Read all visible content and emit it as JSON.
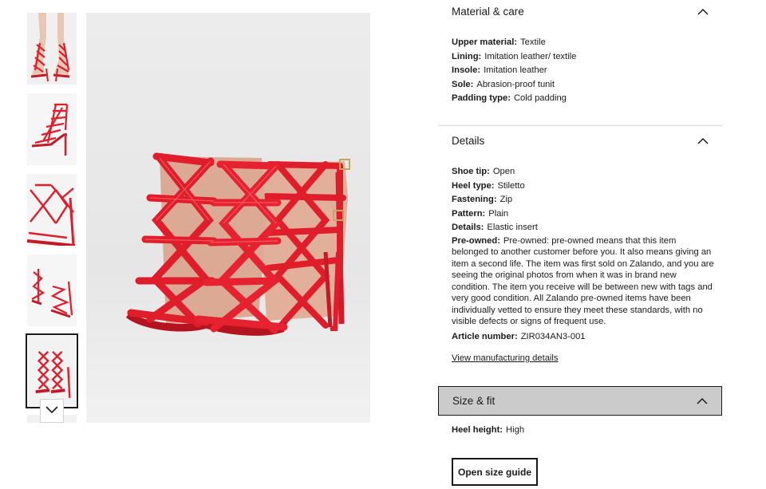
{
  "gallery": {
    "thumbnails": [
      {
        "view": "worn-on-feet"
      },
      {
        "view": "side-view"
      },
      {
        "view": "back-detail"
      },
      {
        "view": "pair-top-view"
      },
      {
        "view": "front-pair",
        "selected": true
      }
    ],
    "next_icon": "chevron-down-icon",
    "main_view": "front-pair"
  },
  "material_care": {
    "title": "Material & care",
    "icon": "chevron-up-icon",
    "rows": [
      {
        "key": "Upper material:",
        "value": "Textile"
      },
      {
        "key": "Lining:",
        "value": "Imitation leather/ textile"
      },
      {
        "key": "Insole:",
        "value": "Imitation leather"
      },
      {
        "key": "Sole:",
        "value": "Abrasion-proof tunit"
      },
      {
        "key": "Padding type:",
        "value": "Cold padding"
      }
    ]
  },
  "details": {
    "title": "Details",
    "icon": "chevron-up-icon",
    "rows": [
      {
        "key": "Shoe tip:",
        "value": "Open"
      },
      {
        "key": "Heel type:",
        "value": "Stiletto"
      },
      {
        "key": "Fastening:",
        "value": "Zip"
      },
      {
        "key": "Pattern:",
        "value": "Plain"
      },
      {
        "key": "Details:",
        "value": "Elastic insert"
      },
      {
        "key": "Pre-owned:",
        "value": "Pre-owned: pre-owned means that this item belonged to another customer before you. It also means giving an item a second life. The item was first sold on Zalando, and you are seeing the original photos from when it was in brand new condition. The item you receive will be between new with tags and very good condition. All Zalando pre-owned items have been individually vetted to ensure they meet these standards, with no visible defects or signs of frequent use."
      },
      {
        "key": "Article number:",
        "value": "ZIR034AN3-001"
      }
    ],
    "manufacturing_link": "View manufacturing details"
  },
  "size_fit": {
    "title": "Size & fit",
    "icon": "chevron-up-icon",
    "rows": [
      {
        "key": "Heel height:",
        "value": "High"
      }
    ],
    "size_guide_button": "Open size guide"
  },
  "colors": {
    "shoe_red": "#e01e2b",
    "shoe_dark_red": "#b3141f",
    "insole": "#e8b49a",
    "active_header_bg": "#cbcbcb"
  }
}
